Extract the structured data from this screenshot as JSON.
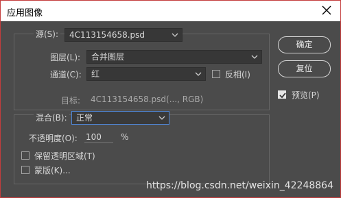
{
  "dialog": {
    "title": "应用图像"
  },
  "source": {
    "label": "源(S):",
    "value": "4C113154658.psd"
  },
  "layer": {
    "label": "图层(L):",
    "value": "合并图层"
  },
  "channel": {
    "label": "通道(C):",
    "value": "红"
  },
  "invert": {
    "label": "反相(I)",
    "checked": false
  },
  "target": {
    "label": "目标:",
    "value": "4C113154658.psd(..., RGB)"
  },
  "blending": {
    "label": "混合(B):",
    "value": "正常"
  },
  "opacity": {
    "label": "不透明度(O):",
    "value": "100",
    "unit": "%"
  },
  "preserve_transparency": {
    "label": "保留透明区域(T)",
    "checked": false
  },
  "mask": {
    "label": "蒙版(K)...",
    "checked": false
  },
  "buttons": {
    "ok": "确定",
    "reset": "复位"
  },
  "preview": {
    "label": "预览(P)",
    "checked": true
  },
  "watermark": "https://blog.csdn.net/weixin_42248864",
  "colors": {
    "focus_border": "#4f86d6",
    "dialog_bg": "#4b4b4b",
    "window_border": "#c43c3c"
  }
}
